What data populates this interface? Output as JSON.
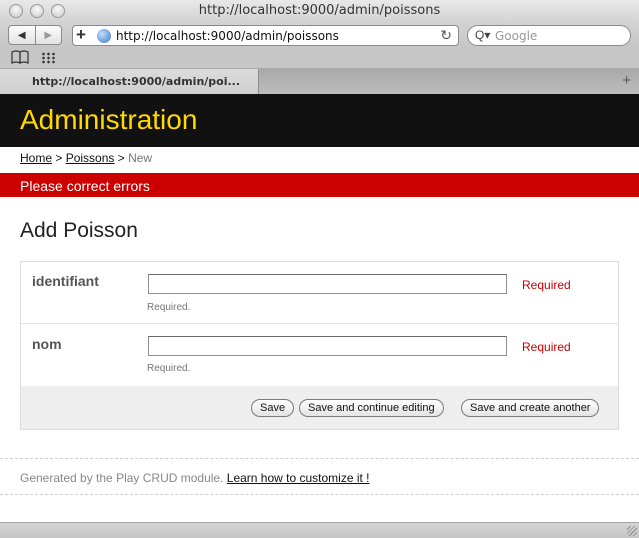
{
  "window": {
    "title": "http://localhost:9000/admin/poissons"
  },
  "toolbar": {
    "back_icon": "back-arrow-icon",
    "back_glyph": "◀",
    "forward_glyph": "▶",
    "add_glyph": "+",
    "url": "http://localhost:9000/admin/poissons",
    "reload_glyph": "↻",
    "search_glyph": "Q▾",
    "search_placeholder": "Google"
  },
  "bookmarks": {
    "book_glyph": "📖"
  },
  "tabs": [
    {
      "label": "http://localhost:9000/admin/poi...",
      "active": true
    }
  ],
  "tabbar": {
    "new_tab_glyph": "+"
  },
  "header": {
    "title": "Administration",
    "bg_color": "#111111",
    "title_color": "#ffd900"
  },
  "breadcrumb": {
    "home": "Home",
    "sep1": " > ",
    "section": "Poissons",
    "sep2": " > ",
    "current": "New"
  },
  "error": {
    "message": "Please correct errors",
    "color": "#cc0000"
  },
  "page": {
    "title": "Add Poisson"
  },
  "form": {
    "fields": [
      {
        "label": "identifiant",
        "value": "",
        "error": "Required",
        "help": "Required."
      },
      {
        "label": "nom",
        "value": "",
        "error": "Required",
        "help": "Required."
      }
    ],
    "buttons": {
      "save": "Save",
      "save_continue": "Save and continue editing",
      "save_another": "Save and create another"
    }
  },
  "footer": {
    "text": "Generated by the Play CRUD module.",
    "link": "Learn how to customize it !"
  }
}
